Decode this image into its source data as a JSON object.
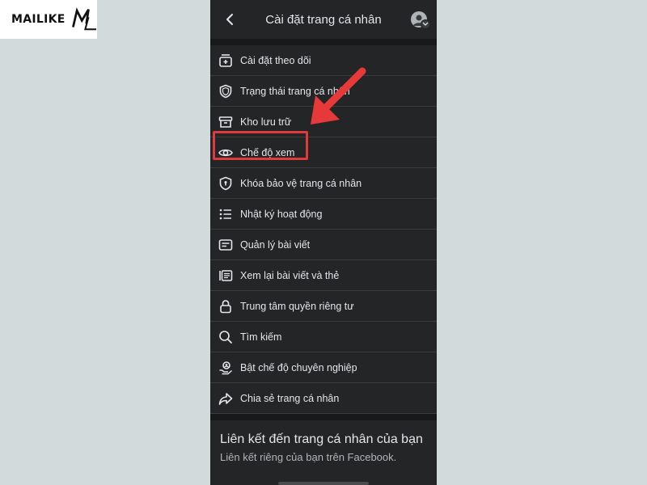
{
  "watermark": {
    "brand_text": "MAILIKE",
    "monogram_text": "ML"
  },
  "header": {
    "title": "Cài đặt trang cá nhân"
  },
  "menu": {
    "items": [
      {
        "label": "Cài đặt theo dõi",
        "icon": "follow-settings-icon"
      },
      {
        "label": "Trạng thái trang cá nhân",
        "icon": "shield-icon"
      },
      {
        "label": "Kho lưu trữ",
        "icon": "archive-icon"
      },
      {
        "label": "Chế độ xem",
        "icon": "eye-icon"
      },
      {
        "label": "Khóa bảo vệ trang cá nhân",
        "icon": "profile-lock-icon"
      },
      {
        "label": "Nhật ký hoạt động",
        "icon": "activity-list-icon"
      },
      {
        "label": "Quản lý bài viết",
        "icon": "manage-posts-icon"
      },
      {
        "label": "Xem lại bài viết và thẻ",
        "icon": "review-posts-icon"
      },
      {
        "label": "Trung tâm quyền riêng tư",
        "icon": "lock-icon"
      },
      {
        "label": "Tìm kiếm",
        "icon": "search-icon"
      },
      {
        "label": "Bật chế độ chuyên nghiệp",
        "icon": "professional-mode-icon"
      },
      {
        "label": "Chia sẻ trang cá nhân",
        "icon": "share-icon"
      }
    ]
  },
  "link_section": {
    "title": "Liên kết đến trang cá nhân của bạn",
    "subtitle": "Liên kết riêng của bạn trên Facebook."
  },
  "colors": {
    "highlight": "#e03a3c",
    "arrow": "#e8393a",
    "panel_bg": "#242526",
    "text": "#e4e6eb"
  }
}
